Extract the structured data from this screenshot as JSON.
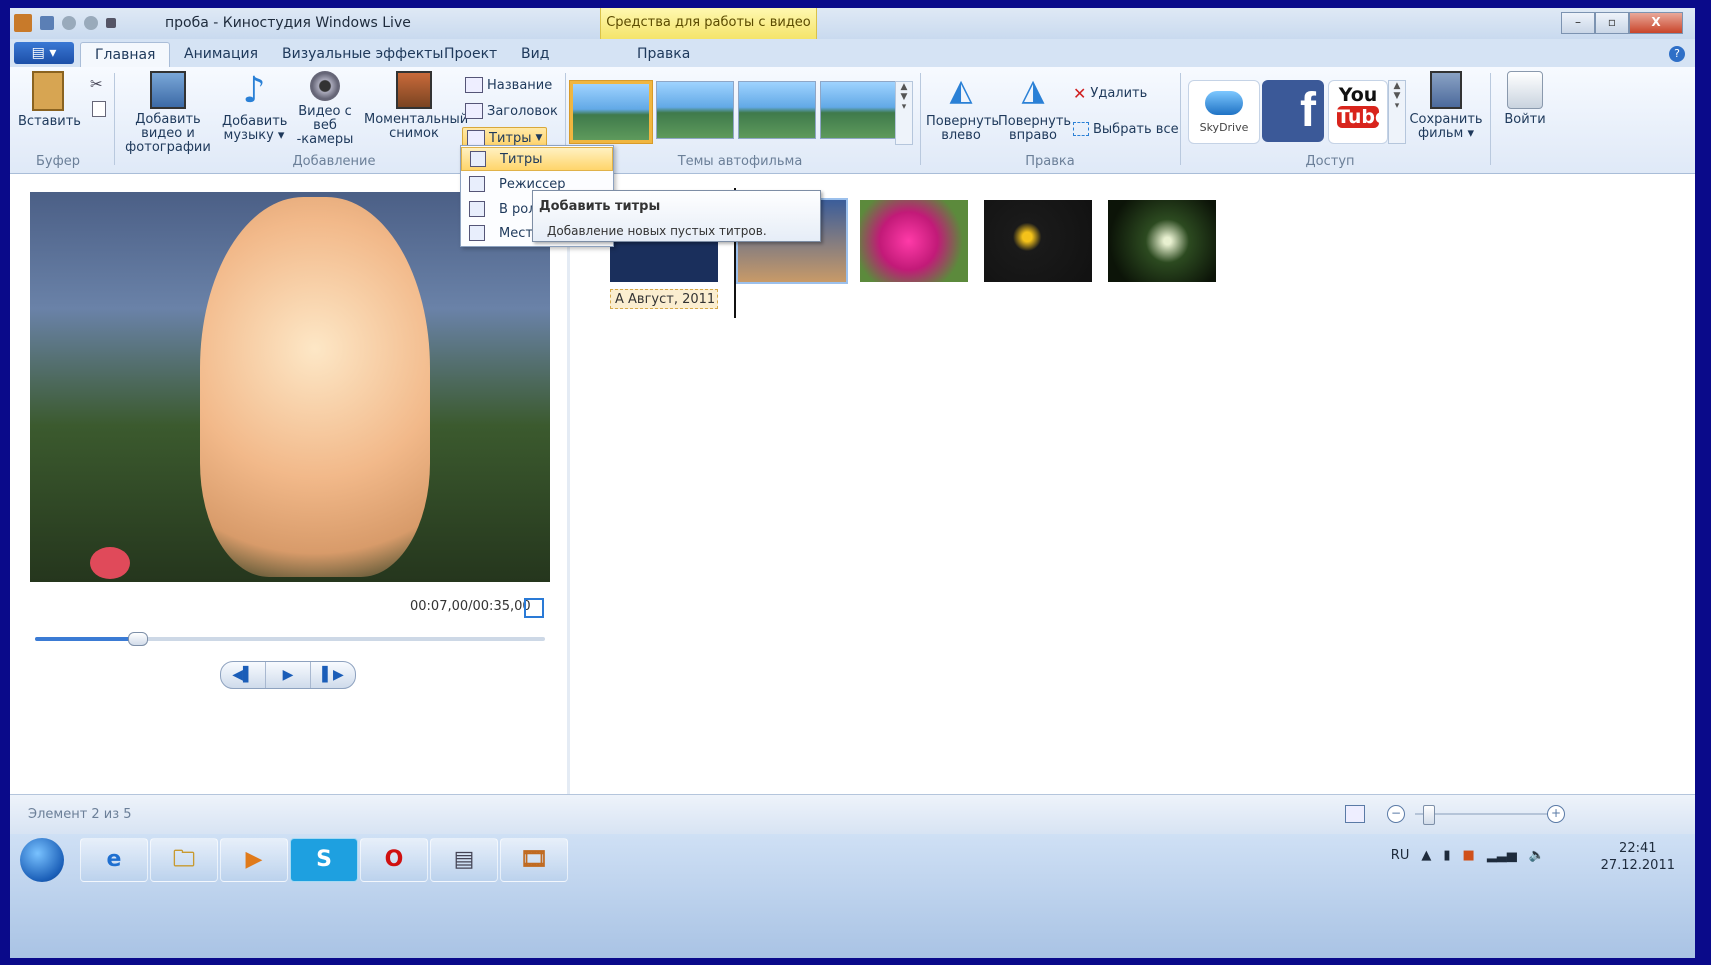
{
  "window": {
    "title": "проба - Киностудия Windows Live",
    "context_tab": "Средства для работы с видео",
    "buttons": [
      "–",
      "▫",
      "X"
    ]
  },
  "tabs": {
    "file": "▤ ▾",
    "items": [
      "Главная",
      "Анимация",
      "Визуальные эффекты",
      "Проект",
      "Вид",
      "Правка"
    ],
    "help": "?"
  },
  "ribbon": {
    "groups": [
      "Буфер",
      "Добавление",
      "Темы автофильма",
      "Правка",
      "Доступ"
    ],
    "paste": "Вставить",
    "add_video": "Добавить видео и фотографии",
    "add_music": "Добавить музыку ▾",
    "webcam": "Видео с веб -камеры",
    "snapshot": "Моментальный снимок",
    "title_btn": "Название",
    "caption_btn": "Заголовок",
    "credits_btn": "Титры",
    "rotate_left": "Повернуть влево",
    "rotate_right": "Повернуть вправо",
    "delete": "Удалить",
    "select_all": "Выбрать все",
    "skydrive": "SkyDrive",
    "youtube_you": "You",
    "youtube_tube": "Tube",
    "facebook": "f",
    "save_movie": "Сохранить фильм ▾",
    "signin": "Войти"
  },
  "menu": {
    "items": [
      "Титры",
      "Режиссер",
      "В рол",
      "Мест"
    ]
  },
  "tooltip": {
    "title": "Добавить титры",
    "description": "Добавление новых пустых титров."
  },
  "preview": {
    "timecode": "00:07,00/00:35,00",
    "progress": 0.2,
    "controls": [
      "◀▌",
      "▶",
      "▌▶"
    ]
  },
  "storyboard": {
    "caption": "A Август, 2011"
  },
  "status": {
    "text": "Элемент 2 из 5"
  },
  "taskbar": {
    "items": [
      "e",
      "🗀",
      "▶",
      "S",
      "O",
      "▤",
      "🎞"
    ],
    "lang": "RU",
    "time": "22:41",
    "date": "27.12.2011"
  },
  "colors": {
    "ribbon_bg": "#dfe9f7",
    "context_tab": "#f4e46a",
    "highlight": "#ffd56b",
    "frame_border": "#0a0a8a"
  }
}
